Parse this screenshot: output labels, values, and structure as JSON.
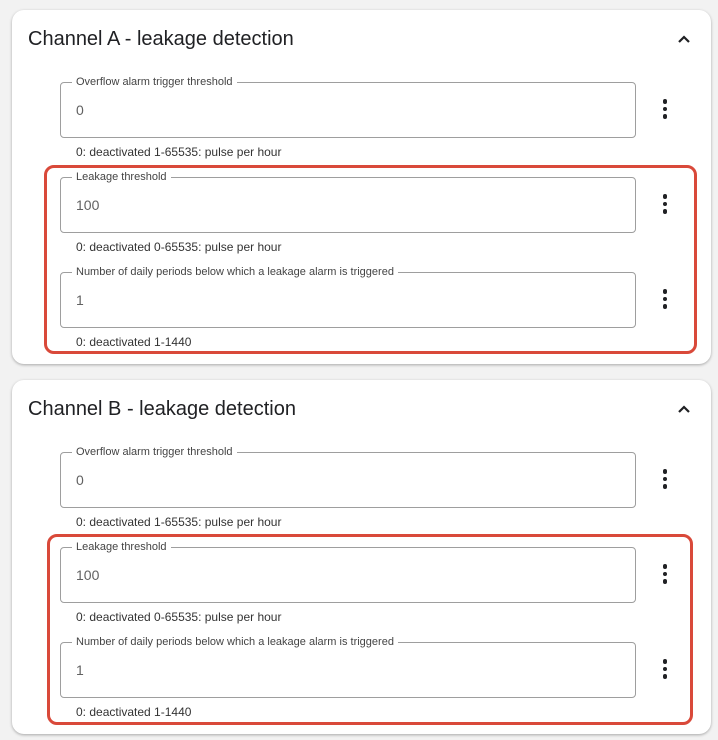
{
  "accent": {
    "highlight": "#d9493a"
  },
  "channel_a": {
    "title": "Channel A - leakage detection",
    "collapse_icon": "chevron-up-icon",
    "fields": [
      {
        "label": "Overflow alarm trigger threshold",
        "value": "0",
        "hint": "0: deactivated 1-65535: pulse per hour",
        "menu_icon": "more-vert-icon"
      },
      {
        "label": "Leakage threshold",
        "value": "100",
        "hint": "0: deactivated 0-65535: pulse per hour",
        "menu_icon": "more-vert-icon"
      },
      {
        "label": "Number of daily periods below which a leakage alarm is triggered",
        "value": "1",
        "hint": "0: deactivated 1-1440",
        "menu_icon": "more-vert-icon"
      }
    ]
  },
  "channel_b": {
    "title": "Channel B - leakage detection",
    "collapse_icon": "chevron-up-icon",
    "fields": [
      {
        "label": "Overflow alarm trigger threshold",
        "value": "0",
        "hint": "0: deactivated 1-65535: pulse per hour",
        "menu_icon": "more-vert-icon"
      },
      {
        "label": "Leakage threshold",
        "value": "100",
        "hint": "0: deactivated 0-65535: pulse per hour",
        "menu_icon": "more-vert-icon"
      },
      {
        "label": "Number of daily periods below which a leakage alarm is triggered",
        "value": "1",
        "hint": "0: deactivated 1-1440",
        "menu_icon": "more-vert-icon"
      }
    ]
  }
}
